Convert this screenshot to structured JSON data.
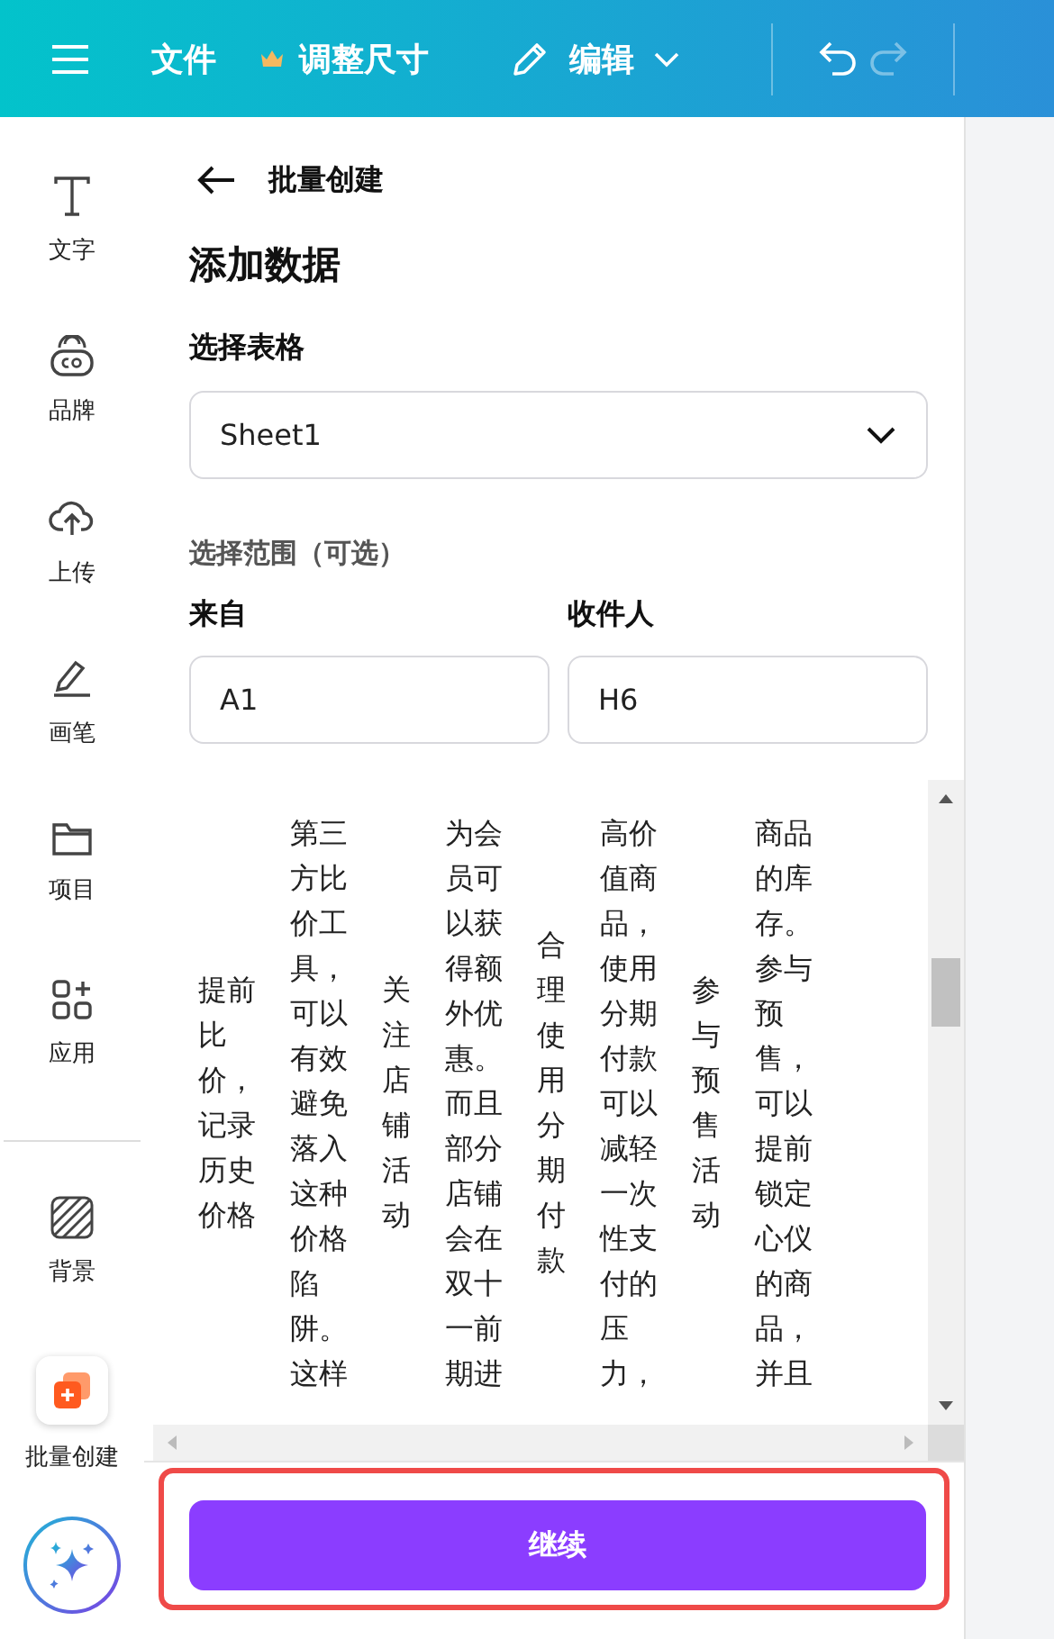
{
  "toolbar": {
    "items": [
      {
        "kind": "menu"
      },
      {
        "kind": "text",
        "label": "文件"
      },
      {
        "kind": "crown",
        "label": "调整尺寸"
      },
      {
        "kind": "edit",
        "label": "编辑"
      },
      {
        "kind": "undo",
        "disabled": false
      },
      {
        "kind": "redo",
        "disabled": true
      }
    ]
  },
  "sidebar": {
    "items": [
      {
        "kind": "text",
        "label": "文字"
      },
      {
        "kind": "brand",
        "label": "品牌"
      },
      {
        "kind": "upload",
        "label": "上传"
      },
      {
        "kind": "draw",
        "label": "画笔"
      },
      {
        "kind": "folder",
        "label": "项目"
      },
      {
        "kind": "apps",
        "label": "应用"
      },
      {
        "kind": "background",
        "label": "背景"
      },
      {
        "kind": "bulk",
        "label": "批量创建"
      }
    ]
  },
  "panel": {
    "back_title": "批量创建",
    "heading": "添加数据",
    "sheet_label": "选择表格",
    "sheet_value": "Sheet1",
    "range_label": "选择范围（可选）",
    "from_label": "来自",
    "from_value": "A1",
    "to_label": "收件人",
    "to_value": "H6",
    "table_columns": [
      {
        "kind": "wide",
        "text": "提前比价，记录历史价格"
      },
      {
        "kind": "wide",
        "text": "第三方比价工具，可以有效避免落入这种价格陷阱。这样"
      },
      {
        "kind": "narrow",
        "text": "关注店铺活动"
      },
      {
        "kind": "wide",
        "text": "为会员可以获得额外优惠。而且部分店铺会在双十一前期进"
      },
      {
        "kind": "narrow",
        "text": "合理使用分期付款"
      },
      {
        "kind": "wide",
        "text": "高价值商品，使用分期付款可以减轻一次性支付的压力，"
      },
      {
        "kind": "narrow",
        "text": "参与预售活动"
      },
      {
        "kind": "wide",
        "text": "商品的库存。参与预售，可以提前锁定心仪的商品，并且"
      }
    ],
    "continue_button": "继续"
  }
}
